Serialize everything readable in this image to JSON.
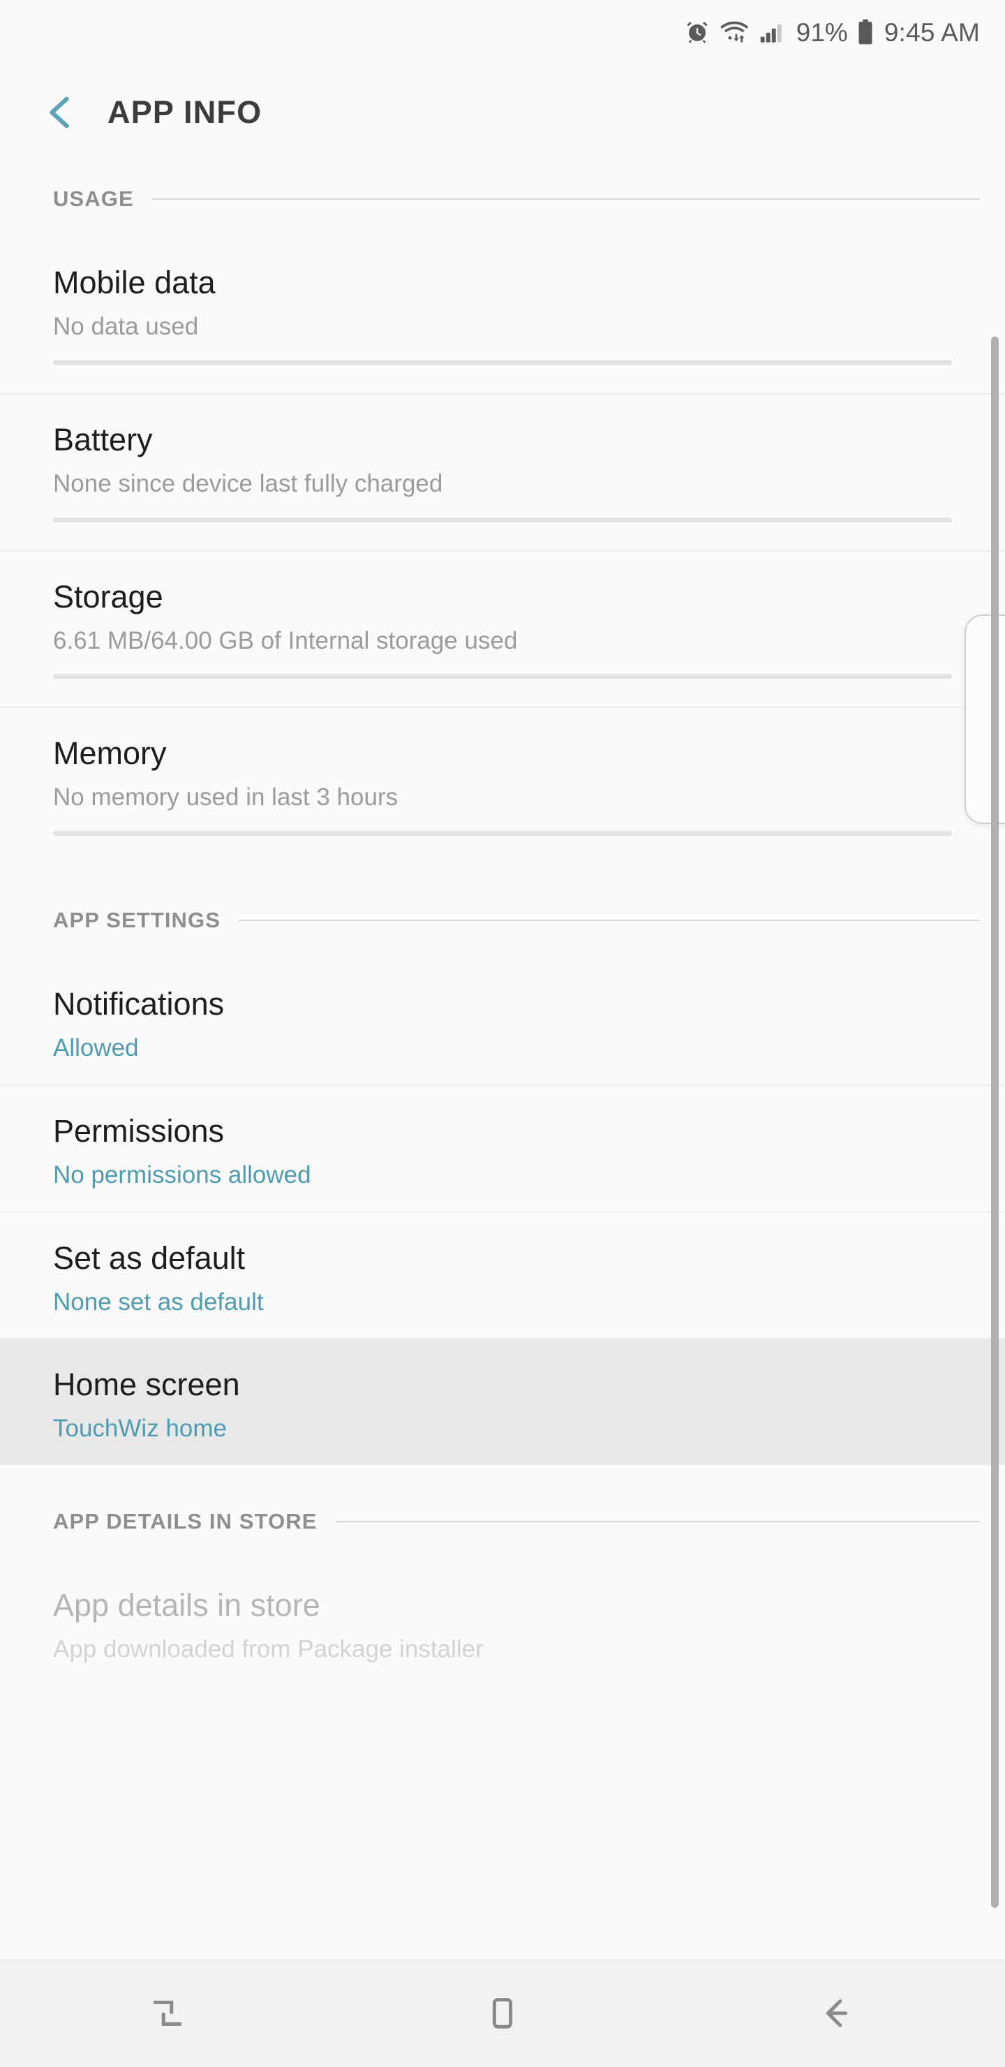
{
  "status_bar": {
    "icons": [
      "alarm-icon",
      "wifi-icon",
      "signal-icon",
      "battery-icon"
    ],
    "battery_percent": "91%",
    "time": "9:45 AM"
  },
  "header": {
    "back_icon": "chevron-left-icon",
    "title": "APP INFO",
    "accent_color": "#4f9bb2",
    "title_color": "#3c3c3c"
  },
  "sections": [
    {
      "label": "USAGE",
      "rows": [
        {
          "title": "Mobile data",
          "subtitle": "No data used",
          "sub_accent": false,
          "usage_bar": true,
          "disabled": false,
          "pressed": false
        },
        {
          "title": "Battery",
          "subtitle": "None since device last fully charged",
          "sub_accent": false,
          "usage_bar": true,
          "disabled": false,
          "pressed": false
        },
        {
          "title": "Storage",
          "subtitle": "6.61 MB/64.00 GB of Internal storage used",
          "sub_accent": false,
          "usage_bar": true,
          "disabled": false,
          "pressed": false
        },
        {
          "title": "Memory",
          "subtitle": "No memory used in last 3 hours",
          "sub_accent": false,
          "usage_bar": true,
          "disabled": false,
          "pressed": false
        }
      ]
    },
    {
      "label": "APP SETTINGS",
      "rows": [
        {
          "title": "Notifications",
          "subtitle": "Allowed",
          "sub_accent": true,
          "usage_bar": false,
          "disabled": false,
          "pressed": false
        },
        {
          "title": "Permissions",
          "subtitle": "No permissions allowed",
          "sub_accent": true,
          "usage_bar": false,
          "disabled": false,
          "pressed": false
        },
        {
          "title": "Set as default",
          "subtitle": "None set as default",
          "sub_accent": true,
          "usage_bar": false,
          "disabled": false,
          "pressed": false
        },
        {
          "title": "Home screen",
          "subtitle": "TouchWiz home",
          "sub_accent": true,
          "usage_bar": false,
          "disabled": false,
          "pressed": true
        }
      ]
    },
    {
      "label": "APP DETAILS IN STORE",
      "rows": [
        {
          "title": "App details in store",
          "subtitle": "App downloaded from Package installer",
          "sub_accent": false,
          "usage_bar": false,
          "disabled": true,
          "pressed": false
        }
      ]
    }
  ],
  "scrollbar": {
    "name": "vertical-scrollbar"
  },
  "nav_bar": {
    "buttons": [
      {
        "icon": "recents-icon",
        "name": "nav-recents-button"
      },
      {
        "icon": "home-icon",
        "name": "nav-home-button"
      },
      {
        "icon": "back-icon",
        "name": "nav-back-button"
      }
    ]
  }
}
